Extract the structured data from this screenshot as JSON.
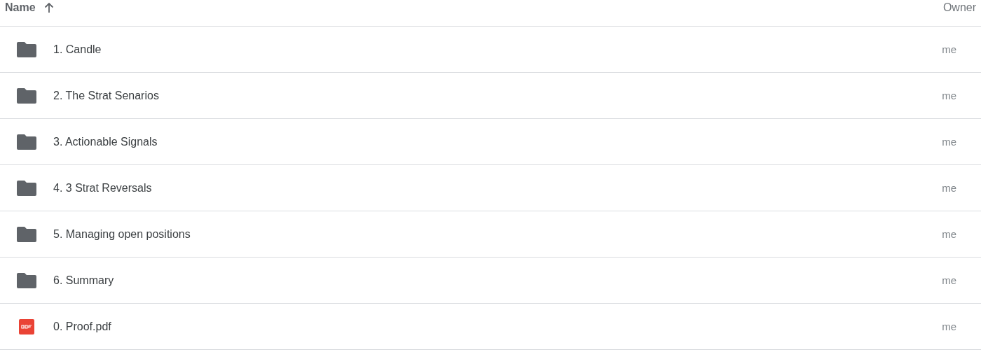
{
  "columns": [
    {
      "label": "Name",
      "sorted": true,
      "ascending": true
    },
    {
      "label": "Owner"
    }
  ],
  "files": [
    {
      "kind": "folder",
      "name": "1. Candle",
      "owner": "me"
    },
    {
      "kind": "folder",
      "name": "2. The Strat Senarios",
      "owner": "me"
    },
    {
      "kind": "folder",
      "name": "3. Actionable Signals",
      "owner": "me"
    },
    {
      "kind": "folder",
      "name": "4. 3 Strat Reversals",
      "owner": "me"
    },
    {
      "kind": "folder",
      "name": "5. Managing open positions",
      "owner": "me"
    },
    {
      "kind": "folder",
      "name": "6. Summary",
      "owner": "me"
    },
    {
      "kind": "pdf",
      "name": "0. Proof.pdf",
      "owner": "me"
    }
  ]
}
